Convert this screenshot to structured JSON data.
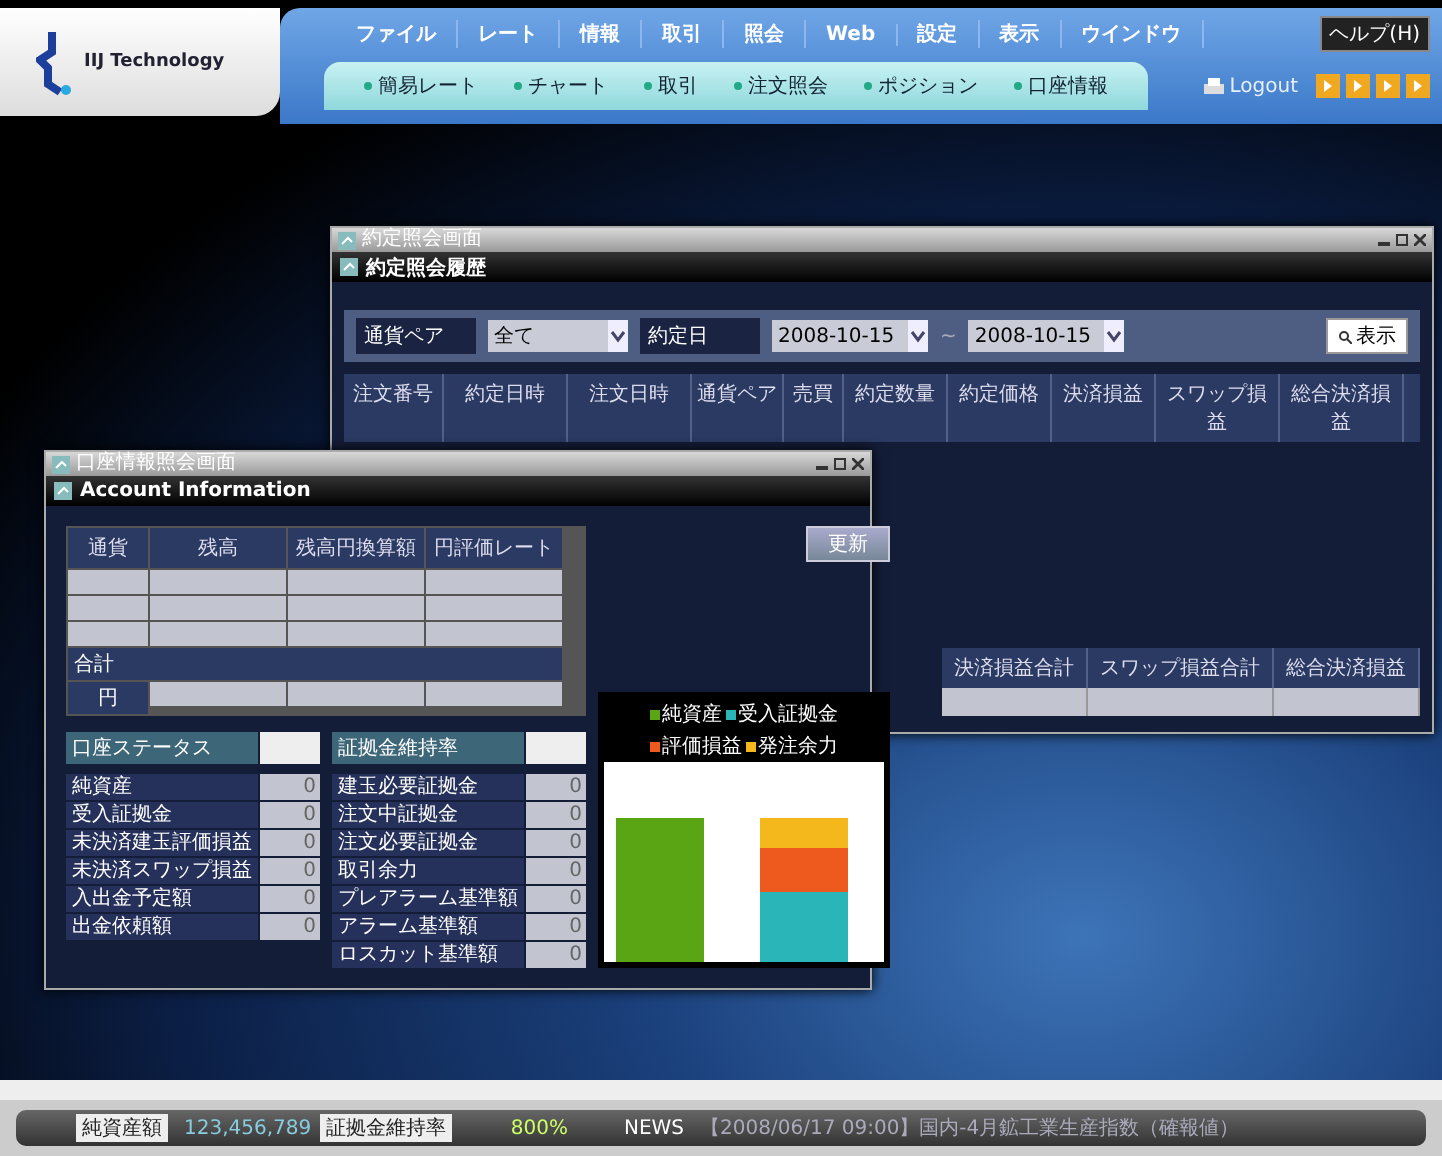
{
  "app": {
    "logo_text": "IIJ Technology",
    "help": "ヘルプ(H)",
    "logout": "Logout"
  },
  "menu": [
    {
      "label": "ファイル"
    },
    {
      "label": "レート"
    },
    {
      "label": "情報"
    },
    {
      "label": "取引"
    },
    {
      "label": "照会"
    },
    {
      "label": "Web"
    },
    {
      "label": "設定"
    },
    {
      "label": "表示"
    },
    {
      "label": "ウインドウ"
    }
  ],
  "submenu": [
    {
      "label": "簡易レート"
    },
    {
      "label": "チャート"
    },
    {
      "label": "取引"
    },
    {
      "label": "注文照会"
    },
    {
      "label": "ポジション"
    },
    {
      "label": "口座情報"
    }
  ],
  "execution_window": {
    "title": "約定照会画面",
    "heading": "約定照会履歴",
    "filters": {
      "pair_label": "通貨ペア",
      "pair_value": "全て",
      "date_label": "約定日",
      "date_from": "2008-10-15",
      "separator": "~",
      "date_to": "2008-10-15",
      "button": "表示"
    },
    "columns": [
      "注文番号",
      "約定日時",
      "注文日時",
      "通貨ペア",
      "売買",
      "約定数量",
      "約定価格",
      "決済損益",
      "スワップ損益",
      "総合決済損益"
    ],
    "totals": [
      "決済損益合計",
      "スワップ損益合計",
      "総合決済損益"
    ]
  },
  "account_window": {
    "title": "口座情報照会画面",
    "heading": "Account Information",
    "button": "更新",
    "columns": [
      "通貨",
      "残高",
      "残高円換算額",
      "円評価レート"
    ],
    "total_label": "合計",
    "total_currency": "円",
    "left_header": "口座ステータス",
    "left_rows": [
      {
        "label": "純資産",
        "value": "0"
      },
      {
        "label": "受入証拠金",
        "value": "0"
      },
      {
        "label": "未決済建玉評価損益",
        "value": "0"
      },
      {
        "label": "未決済スワップ損益",
        "value": "0"
      },
      {
        "label": "入出金予定額",
        "value": "0"
      },
      {
        "label": "出金依頼額",
        "value": "0"
      }
    ],
    "right_header": "証拠金維持率",
    "right_rows": [
      {
        "label": "建玉必要証拠金",
        "value": "0"
      },
      {
        "label": "注文中証拠金",
        "value": "0"
      },
      {
        "label": "注文必要証拠金",
        "value": "0"
      },
      {
        "label": "取引余力",
        "value": "0"
      },
      {
        "label": "プレアラーム基準額",
        "value": "0"
      },
      {
        "label": "アラーム基準額",
        "value": "0"
      },
      {
        "label": "ロスカット基準額",
        "value": "0"
      }
    ],
    "chart": {
      "legend": [
        {
          "label": "純資産",
          "color": "#5aa514"
        },
        {
          "label": "受入証拠金",
          "color": "#2ab5b8"
        },
        {
          "label": "評価損益",
          "color": "#ee5a1e"
        },
        {
          "label": "発注余力",
          "color": "#f4b81c"
        }
      ]
    }
  },
  "status_bar": {
    "equity_label": "純資産額",
    "equity": "123,456,789",
    "ratio_label": "証拠金維持率",
    "ratio": "800%",
    "news_label": "NEWS",
    "news": "【2008/06/17 09:00】国内-4月鉱工業生産指数（確報値）"
  }
}
